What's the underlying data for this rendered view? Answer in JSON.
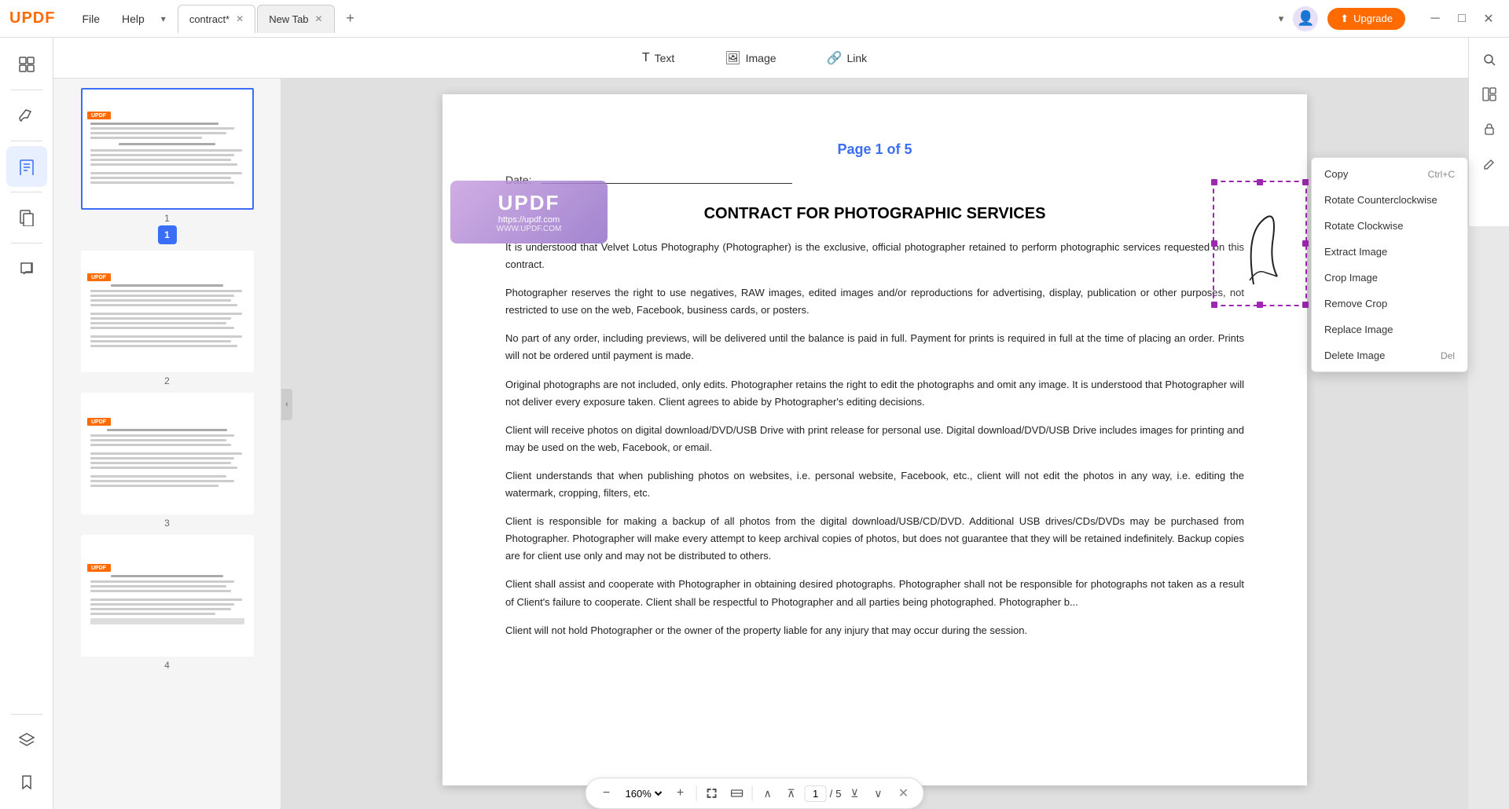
{
  "app": {
    "logo": "UPDF",
    "accent_color": "#ff6b00"
  },
  "menu": {
    "file": "File",
    "help": "Help"
  },
  "tabs": [
    {
      "label": "contract*",
      "active": true,
      "closable": true
    },
    {
      "label": "New Tab",
      "active": false,
      "closable": true
    }
  ],
  "tab_add_label": "+",
  "topbar_right": {
    "upgrade_label": "Upgrade"
  },
  "edit_toolbar": {
    "text_label": "Text",
    "image_label": "Image",
    "link_label": "Link"
  },
  "page_header": {
    "text": "Page 1 of 5"
  },
  "date_label": "Date:",
  "contract": {
    "title": "CONTRACT FOR PHOTOGRAPHIC SERVICES",
    "paragraphs": [
      "It is understood that Velvet Lotus Photography (Photographer) is the exclusive, official photographer retained to perform photographic services requested on this contract.",
      "Photographer reserves the right to use negatives, RAW images, edited images and/or reproductions for advertising, display, publication or other purposes, not restricted to use on the web, Facebook, business cards, or posters.",
      "No part of any order, including previews, will be delivered until the balance is paid in full. Payment for prints is required in full at the time of placing an order. Prints will not be ordered until payment is made.",
      "Original photographs are not included, only edits. Photographer retains the right to edit the photographs and omit any image. It is understood that Photographer will not deliver every exposure taken. Client agrees to abide by Photographer's editing decisions.",
      "Client will receive photos on digital download/DVD/USB Drive with print release for personal use. Digital download/DVD/USB Drive includes images for printing and may be used on the web, Facebook, or email.",
      "Client understands that when publishing photos on websites, i.e. personal website, Facebook, etc., client will not edit the photos in any way, i.e. editing the watermark, cropping, filters, etc.",
      "Client is responsible for making a backup of all photos from the digital download/USB/CD/DVD. Additional USB drives/CDs/DVDs may be purchased from Photographer. Photographer will make every attempt to keep archival copies of photos, but does not guarantee that they will be retained indefinitely. Backup copies are for client use only and may not be distributed to others.",
      "Client shall assist and cooperate with Photographer in obtaining desired photographs. Photographer shall not be responsible for photographs not taken as a result of Client's failure to cooperate. Client shall be respectful to Photographer and all parties being photographed. Photographer b...",
      "Client will not hold Photographer or the owner of the property liable for any injury that may occur during the session."
    ]
  },
  "context_menu": {
    "items": [
      {
        "label": "Copy",
        "shortcut": "Ctrl+C"
      },
      {
        "label": "Rotate Counterclockwise",
        "shortcut": ""
      },
      {
        "label": "Rotate Clockwise",
        "shortcut": ""
      },
      {
        "label": "Extract Image",
        "shortcut": ""
      },
      {
        "label": "Crop Image",
        "shortcut": ""
      },
      {
        "label": "Remove Crop",
        "shortcut": ""
      },
      {
        "label": "Replace Image",
        "shortcut": ""
      },
      {
        "label": "Delete Image",
        "shortcut": "Del"
      }
    ]
  },
  "zoom": {
    "value": "160%",
    "decrease_label": "−",
    "increase_label": "+",
    "current_page": "1",
    "total_pages": "5"
  },
  "watermark": {
    "logo": "UPDF",
    "url": "https://updf.com",
    "url2": "WWW.UPDF.COM"
  },
  "thumbnails": [
    {
      "page": "1",
      "active": true
    },
    {
      "page": "2",
      "active": false
    },
    {
      "page": "3",
      "active": false
    },
    {
      "page": "4",
      "active": false
    }
  ],
  "right_sidebar_icons": [
    "🔍",
    "📋",
    "🔒",
    "✏️"
  ],
  "left_sidebar_icons": [
    {
      "name": "thumbnails",
      "icon": "⊞",
      "active": false
    },
    {
      "name": "edit",
      "icon": "✎",
      "active": true
    },
    {
      "name": "pages",
      "icon": "📄",
      "active": false
    },
    {
      "name": "comment",
      "icon": "💬",
      "active": false
    },
    {
      "name": "layers",
      "icon": "◈",
      "active": false
    },
    {
      "name": "bookmarks",
      "icon": "🔖",
      "active": false
    }
  ]
}
